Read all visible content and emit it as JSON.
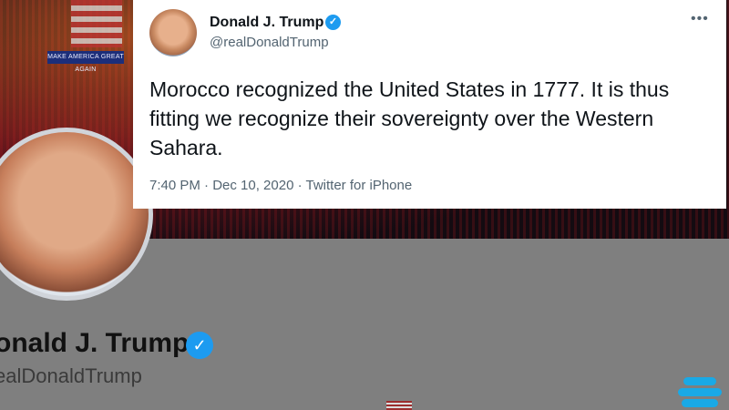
{
  "tweet": {
    "display_name": "Donald J. Trump",
    "handle": "@realDonaldTrump",
    "text": "Morocco recognized the United States in 1777.  It is thus fitting we recognize their sovereignty over the Western Sahara.",
    "meta": "7:40 PM · Dec 10, 2020 · Twitter for iPhone",
    "more_glyph": "•••",
    "verified_icon": "verified-badge-icon"
  },
  "background_profile": {
    "banner_sign": "MAKE AMERICA GREAT AGAIN",
    "name": "onald J. Trump",
    "handle": "ealDonaldTrump",
    "verified_glyph": "✓"
  },
  "colors": {
    "accent": "#1d9bf0",
    "text_primary": "#0f1419",
    "text_secondary": "#536471",
    "logo": "#19a9e6"
  }
}
